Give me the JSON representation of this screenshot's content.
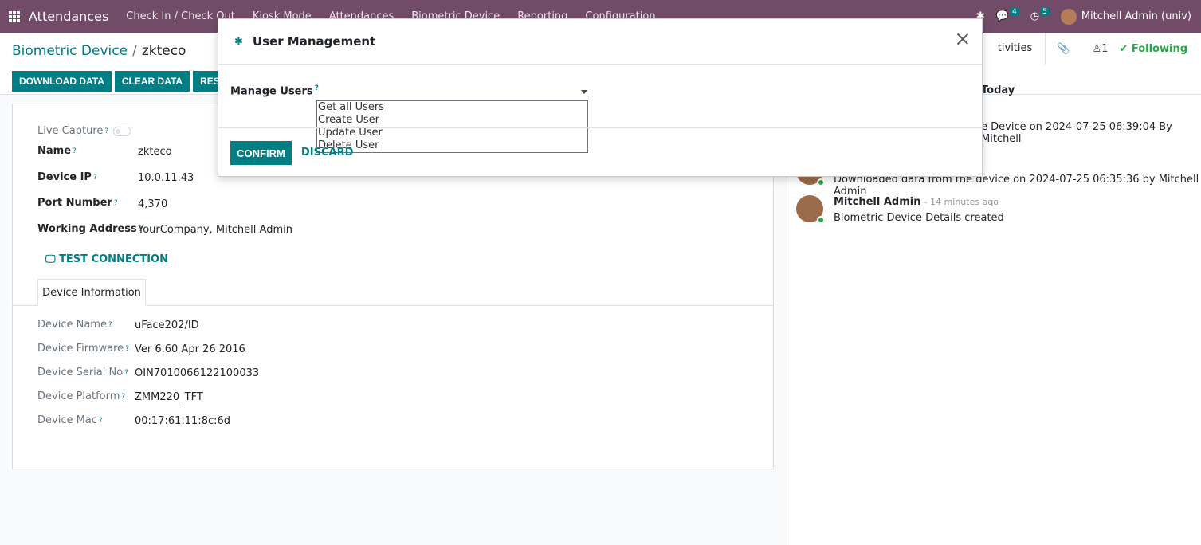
{
  "navbar": {
    "app_name": "Attendances",
    "menus": [
      "Check In / Check Out",
      "Kiosk Mode",
      "Attendances",
      "Biometric Device",
      "Reporting",
      "Configuration"
    ],
    "messages_count": "4",
    "activities_count": "5",
    "user": "Mitchell Admin (univ)"
  },
  "breadcrumb": {
    "parent": "Biometric Device",
    "current": "zkteco"
  },
  "actions": [
    "DOWNLOAD DATA",
    "CLEAR DATA",
    "RES"
  ],
  "chatter_top": {
    "activities": "tivities",
    "followers": "1",
    "following": "Following"
  },
  "form": {
    "live_capture": "Live Capture",
    "name_label": "Name",
    "name": "zkteco",
    "ip_label": "Device IP",
    "ip": "10.0.11.43",
    "port_label": "Port Number",
    "port": "4,370",
    "address_label": "Working Address",
    "address": "YourCompany, Mitchell Admin",
    "test_connection": "TEST CONNECTION",
    "tab": "Device Information",
    "device_name_label": "Device Name",
    "device_name": "uFace202/ID",
    "firmware_label": "Device Firmware",
    "firmware": "Ver 6.60 Apr 26 2016",
    "serial_label": "Device Serial No",
    "serial": "OIN7010066122100033",
    "platform_label": "Device Platform",
    "platform": "ZMM220_TFT",
    "mac_label": "Device Mac",
    "mac": "00:17:61:11:8c:6d"
  },
  "chatter": {
    "today": "Today",
    "msg1": "e Device on 2024-07-25 06:39:04 By Mitchell",
    "msg2": "Downloaded data from the device on 2024-07-25 06:35:36 by Mitchell Admin",
    "author": "Mitchell Admin",
    "time": "- 14 minutes ago",
    "msg3": "Biometric Device Details created"
  },
  "modal": {
    "title": "User Management",
    "field_label": "Manage Users",
    "options": [
      "Get all Users",
      "Create User",
      "Update User",
      "Delete User"
    ],
    "confirm": "CONFIRM",
    "discard": "DISCARD"
  },
  "colors": {
    "brand": "#714b67",
    "accent": "#017e84"
  }
}
